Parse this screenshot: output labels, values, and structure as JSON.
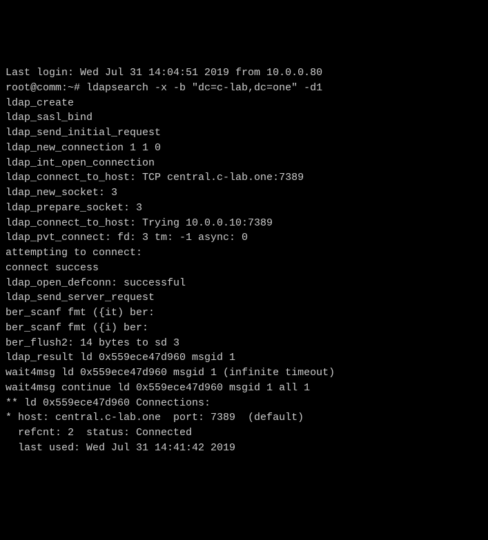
{
  "terminal": {
    "lines": [
      "Last login: Wed Jul 31 14:04:51 2019 from 10.0.0.80",
      "root@comm:~# ldapsearch -x -b \"dc=c-lab,dc=one\" -d1",
      "ldap_create",
      "ldap_sasl_bind",
      "ldap_send_initial_request",
      "ldap_new_connection 1 1 0",
      "ldap_int_open_connection",
      "ldap_connect_to_host: TCP central.c-lab.one:7389",
      "ldap_new_socket: 3",
      "ldap_prepare_socket: 3",
      "ldap_connect_to_host: Trying 10.0.0.10:7389",
      "ldap_pvt_connect: fd: 3 tm: -1 async: 0",
      "attempting to connect:",
      "connect success",
      "ldap_open_defconn: successful",
      "ldap_send_server_request",
      "ber_scanf fmt ({it) ber:",
      "ber_scanf fmt ({i) ber:",
      "ber_flush2: 14 bytes to sd 3",
      "ldap_result ld 0x559ece47d960 msgid 1",
      "wait4msg ld 0x559ece47d960 msgid 1 (infinite timeout)",
      "wait4msg continue ld 0x559ece47d960 msgid 1 all 1",
      "** ld 0x559ece47d960 Connections:",
      "* host: central.c-lab.one  port: 7389  (default)",
      "  refcnt: 2  status: Connected",
      "  last used: Wed Jul 31 14:41:42 2019"
    ]
  }
}
